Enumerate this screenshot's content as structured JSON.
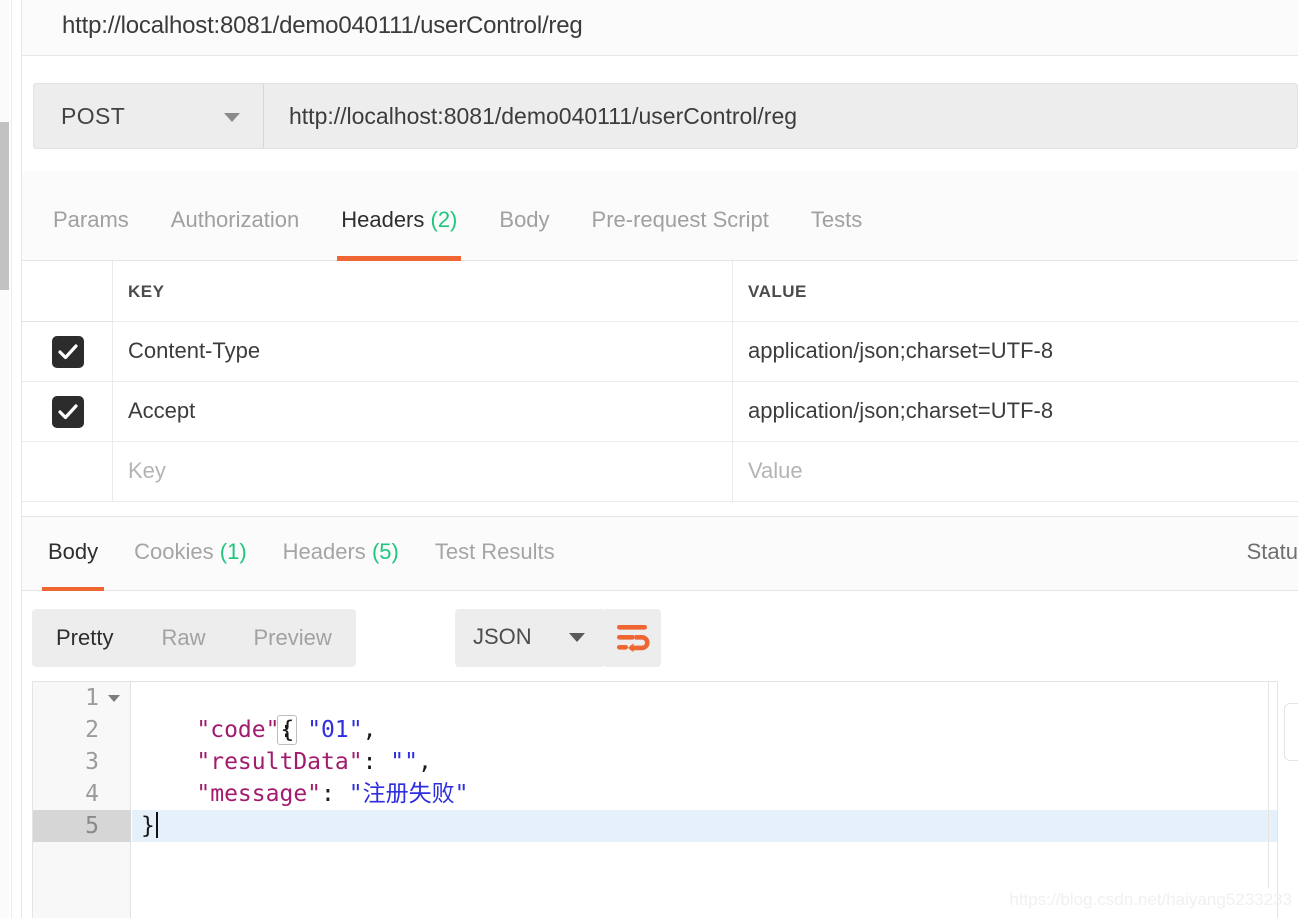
{
  "window": {
    "title": "http://localhost:8081/demo040111/userControl/reg"
  },
  "request": {
    "method": "POST",
    "method_caret_icon": "chevron-down-icon",
    "url": "http://localhost:8081/demo040111/userControl/reg",
    "tabs": [
      {
        "label": "Params",
        "count": "",
        "active": false
      },
      {
        "label": "Authorization",
        "count": "",
        "active": false
      },
      {
        "label": "Headers",
        "count": "(2)",
        "active": true
      },
      {
        "label": "Body",
        "count": "",
        "active": false
      },
      {
        "label": "Pre-request Script",
        "count": "",
        "active": false
      },
      {
        "label": "Tests",
        "count": "",
        "active": false
      }
    ]
  },
  "headers_table": {
    "columns": {
      "key": "KEY",
      "value": "VALUE"
    },
    "rows": [
      {
        "checked": true,
        "key": "Content-Type",
        "value": "application/json;charset=UTF-8",
        "placeholder": false
      },
      {
        "checked": true,
        "key": "Accept",
        "value": "application/json;charset=UTF-8",
        "placeholder": false
      },
      {
        "checked": false,
        "key": "Key",
        "value": "Value",
        "placeholder": true
      }
    ],
    "checkbox_icon": "check-icon"
  },
  "response": {
    "tabs": [
      {
        "label": "Body",
        "count": "",
        "active": true
      },
      {
        "label": "Cookies",
        "count": "(1)",
        "active": false
      },
      {
        "label": "Headers",
        "count": "(5)",
        "active": false
      },
      {
        "label": "Test Results",
        "count": "",
        "active": false
      }
    ],
    "status_label": "Statu",
    "view_modes": [
      {
        "label": "Pretty",
        "active": true
      },
      {
        "label": "Raw",
        "active": false
      },
      {
        "label": "Preview",
        "active": false
      }
    ],
    "format": "JSON",
    "format_caret_icon": "chevron-down-icon",
    "wrap_button_icon": "word-wrap-icon"
  },
  "code": {
    "line_numbers": [
      "1",
      "2",
      "3",
      "4",
      "5"
    ],
    "fold_icon": "fold-triangle-icon",
    "active_line": "5",
    "raw_body": "{\n    \"code\": \"01\",\n    \"resultData\": \"\",\n    \"message\": \"注册失败\"\n}",
    "parsed": {
      "code": "01",
      "resultData": "",
      "message": "注册失败"
    },
    "lines": [
      {
        "n": "1",
        "open_brace": "{"
      },
      {
        "n": "2",
        "indent": "    ",
        "key": "\"code\"",
        "colon": ": ",
        "val": "\"01\"",
        "tail": ","
      },
      {
        "n": "3",
        "indent": "    ",
        "key": "\"resultData\"",
        "colon": ": ",
        "val": "\"\"",
        "tail": ","
      },
      {
        "n": "4",
        "indent": "    ",
        "key": "\"message\"",
        "colon": ": ",
        "val": "\"注册失败\"",
        "tail": ""
      },
      {
        "n": "5",
        "close_brace": "}"
      }
    ]
  },
  "edge_button": {
    "dots": "⋮"
  },
  "watermark": "https://blog.csdn.net/haiyang5233233",
  "colors": {
    "accent_orange": "#f06633",
    "count_green": "#1fc77e",
    "json_key": "#a21b6e",
    "json_string": "#2e2ee0",
    "checkbox_fill": "#2c2c2c",
    "active_line": "#e6f0fb"
  }
}
